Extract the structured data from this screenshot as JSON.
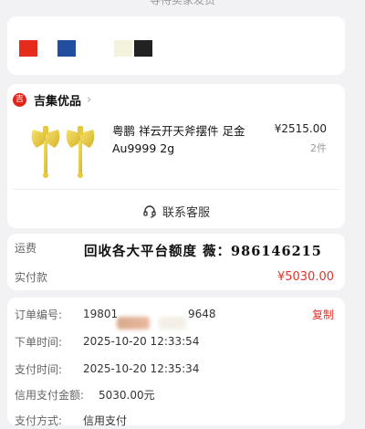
{
  "top_hint": "等待卖家发货",
  "colors": {
    "accent": "#e0352b",
    "swatches": [
      "#e52b1c",
      "#224ea0",
      "#f4f2dc",
      "#222222"
    ]
  },
  "shop": {
    "icon_symbol": "吉",
    "name": "吉集优品",
    "chevron": "›"
  },
  "product": {
    "name": "粤鹏 祥云开天斧摆件 足金 Au9999 2g",
    "price": "¥2515.00",
    "quantity": "2件"
  },
  "contact": {
    "label": "联系客服"
  },
  "summary": {
    "shipping_label": "运费",
    "paid_label": "实付款",
    "paid_value": "¥5030.00"
  },
  "watermark": "回收各大平台额度 薇：986146215",
  "order_info": {
    "order_no_label": "订单编号:",
    "order_no_prefix": "19801",
    "order_no_suffix": "9648",
    "copy_label": "复制",
    "order_time_label": "下单时间:",
    "order_time": "2025-10-20 12:33:54",
    "pay_time_label": "支付时间:",
    "pay_time": "2025-10-20 12:35:34",
    "credit_amount_label": "信用支付金额:",
    "credit_amount": "5030.00元",
    "pay_method_label": "支付方式:",
    "pay_method": "信用支付"
  }
}
